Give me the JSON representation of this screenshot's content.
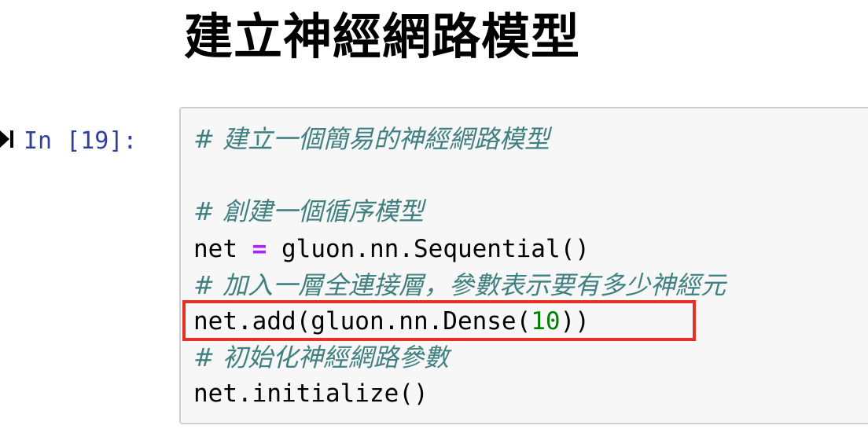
{
  "heading": "建立神經網路模型",
  "cell": {
    "prompt": "In [19]:",
    "run_icon": "step-run-icon",
    "lines": [
      {
        "comment": "# 建立一個簡易的神經網路模型"
      },
      {
        "comment": "# 創建一個循序模型"
      },
      {
        "var": "net",
        "op": "=",
        "rhs": "gluon.nn.Sequential()"
      },
      {
        "comment": "# 加入一層全連接層，參數表示要有多少神經元"
      },
      {
        "prefix": "net.add(gluon.nn.Dense(",
        "num": "10",
        "suffix": "))"
      },
      {
        "comment": "# 初始化神經網路參數"
      },
      {
        "code": "net.initialize()"
      }
    ],
    "highlight_color": "#e53022"
  }
}
